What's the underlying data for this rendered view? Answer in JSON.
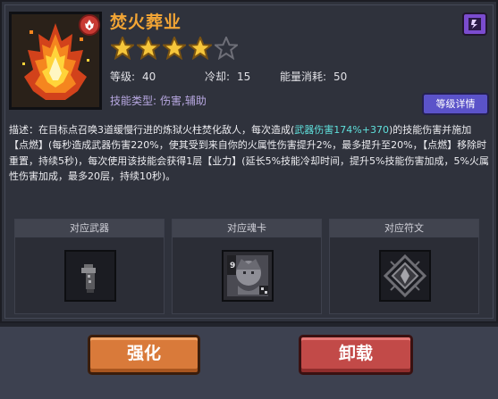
{
  "skill": {
    "name": "焚火葬业",
    "stars_filled": 4,
    "stars_total": 5,
    "stats": [
      {
        "label": "等级:",
        "value": "40"
      },
      {
        "label": "冷却:",
        "value": "15"
      },
      {
        "label": "能量消耗:",
        "value": "50"
      }
    ],
    "type_label": "技能类型:",
    "type_value": "伤害,辅助",
    "icon": "fire-pillar-icon",
    "badge_icon": "fire-element-icon"
  },
  "buttons": {
    "detail": "等级详情",
    "corner_icon": "purple-rune-icon",
    "upgrade": "强化",
    "unequip": "卸载"
  },
  "description": {
    "part1": "描述：在目标点召唤3道缓慢行进的炼狱火柱焚化敌人，每次造成(",
    "highlight": "武器伤害174%+370",
    "part2": ")的技能伤害并施加【点燃】(每秒造成武器伤害220%，使其受到来自你的火属性伤害提升2%，最多提升至20%，【点燃】移除时重置，持续5秒)，每次使用该技能会获得1层【业力】(延长5%技能冷却时间，提升5%技能伤害加成，5%火属性伤害加成，最多20层，持续10秒)。"
  },
  "slots": [
    {
      "title": "对应武器",
      "icon": "sword-hilt-icon"
    },
    {
      "title": "对应魂卡",
      "icon": "soul-card-icon",
      "card_number": "9"
    },
    {
      "title": "对应符文",
      "icon": "rune-crystal-icon"
    }
  ],
  "colors": {
    "title": "#f2a535",
    "highlight": "#5fe0dc",
    "skill_type": "#b7a7e0",
    "detail_button": "#5b53c9",
    "upgrade_button": "#d97a3a",
    "unequip_button": "#c24a48"
  }
}
